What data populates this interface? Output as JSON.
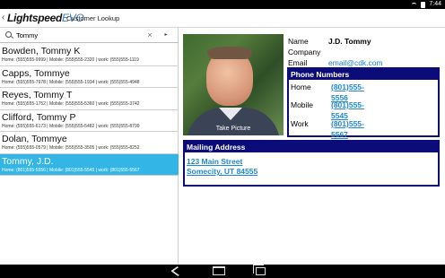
{
  "status_bar": {
    "time": "7:44"
  },
  "app": {
    "logo_main": "Lightspeed",
    "logo_suffix": "EVO",
    "screen_title": "Customer Lookup"
  },
  "search": {
    "value": "Tommy",
    "clear": "×",
    "go": "▸"
  },
  "contacts": [
    {
      "name": "Bowden, Tommy K",
      "phones": "Home: (555)555-9999 | Mobile: (555)555-2320 | work: (555)555-1119",
      "selected": false
    },
    {
      "name": "Capps, Tommye",
      "phones": "Home: (555)555-7978 | Mobile: (555)555-1934 | work: (555)555-4948",
      "selected": false
    },
    {
      "name": "Reyes, Tommy T",
      "phones": "Home: (555)555-1752 | Mobile: (555)555-5360 | work: (555)555-3742",
      "selected": false
    },
    {
      "name": "Clifford, Tommy P",
      "phones": "Home: (555)555-6173 | Mobile: (555)555-5482 | work: (555)555-8799",
      "selected": false
    },
    {
      "name": "Dolan, Tommye",
      "phones": "Home: (555)555-0579 | Mobile: (555)555-3505 | work: (555)555-8252",
      "selected": false
    },
    {
      "name": "Tommy, J.D.",
      "phones": "Home: (801)555-5556 | Mobile: (801)555-5545 | work: (801)555-5567",
      "selected": true
    }
  ],
  "detail": {
    "photo_caption": "Take Picture",
    "labels": {
      "name": "Name",
      "company": "Company",
      "email": "Email"
    },
    "name": "J.D. Tommy",
    "company": "",
    "email": "email@cdk.com",
    "phone_panel": {
      "title": "Phone Numbers",
      "home_label": "Home",
      "home": "(801)555-5556",
      "mobile_label": "Mobile",
      "mobile": "(801)555-5545",
      "work_label": "Work",
      "work": "(801)555-5567"
    },
    "address_panel": {
      "title": "Mailing Address",
      "line1": "123 Main Street",
      "line2": "Somecity, UT 84555"
    }
  },
  "colors": {
    "selected_row": "#33b5e5",
    "panel_header": "#0b0b7a",
    "link": "#1e88d4"
  }
}
